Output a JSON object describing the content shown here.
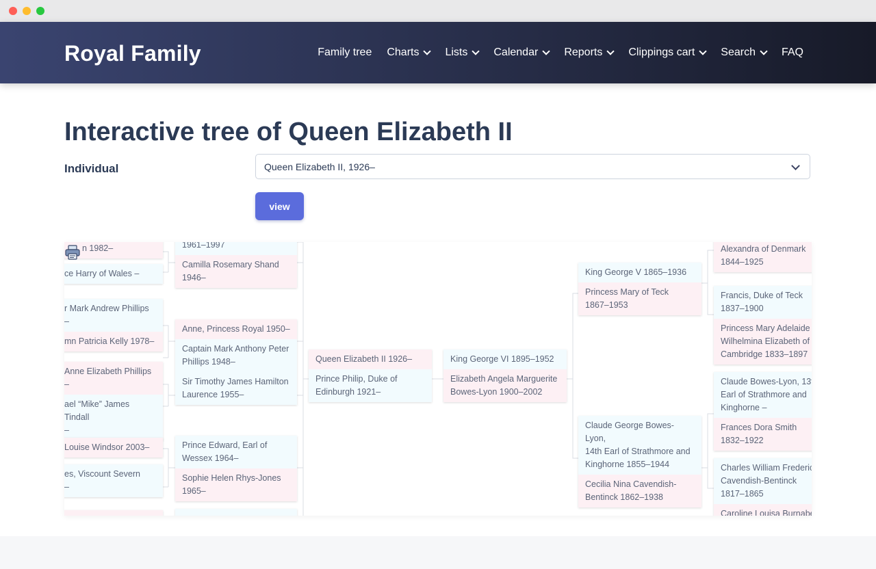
{
  "site": {
    "brand": "Royal Family",
    "menu": [
      {
        "label": "Family tree",
        "dropdown": false
      },
      {
        "label": "Charts",
        "dropdown": true
      },
      {
        "label": "Lists",
        "dropdown": true
      },
      {
        "label": "Calendar",
        "dropdown": true
      },
      {
        "label": "Reports",
        "dropdown": true
      },
      {
        "label": "Clippings cart",
        "dropdown": true
      },
      {
        "label": "Search",
        "dropdown": true
      },
      {
        "label": "FAQ",
        "dropdown": false
      }
    ]
  },
  "page": {
    "title": "Interactive tree of Queen Elizabeth II",
    "individual_label": "Individual",
    "individual_value": "Queen Elizabeth II, 1926–",
    "view_button": "view"
  },
  "tree": {
    "print_icon": "printer-icon",
    "col_desc2": [
      [
        "n 1982–"
      ],
      [
        "ce Harry of Wales –"
      ],
      [
        "r Mark Andrew Phillips",
        "–"
      ],
      [
        "mn Patricia Kelly 1978–"
      ],
      [
        "Anne Elizabeth Phillips",
        "–"
      ],
      [
        "ael “Mike” James Tindall",
        "–"
      ],
      [
        "Louise Windsor 2003–"
      ],
      [
        "es, Viscount Severn",
        "–"
      ]
    ],
    "col_desc1": [
      [
        "1961–1997"
      ],
      [
        "Camilla Rosemary Shand",
        "1946–"
      ],
      [
        "Anne, Princess Royal 1950–"
      ],
      [
        "Captain Mark Anthony Peter",
        "Phillips 1948–"
      ],
      [
        "Sir Timothy James Hamilton",
        "Laurence 1955–"
      ],
      [
        "Prince Edward, Earl of",
        "Wessex 1964–"
      ],
      [
        "Sophie Helen Rhys-Jones",
        "1965–"
      ]
    ],
    "root": [
      [
        "Queen Elizabeth II 1926–"
      ],
      [
        "Prince Philip, Duke of",
        "Edinburgh 1921–"
      ]
    ],
    "parents": [
      [
        "King George VI 1895–1952"
      ],
      [
        "Elizabeth Angela Marguerite",
        "Bowes-Lyon 1900–2002"
      ]
    ],
    "grandparents": [
      [
        "King George V 1865–1936"
      ],
      [
        "Princess Mary of Teck",
        "1867–1953"
      ],
      [
        "Claude George Bowes-Lyon,",
        "14th Earl of Strathmore and",
        "Kinghorne 1855–1944"
      ],
      [
        "Cecilia Nina Cavendish-",
        "Bentinck 1862–1938"
      ]
    ],
    "great_grandparents": [
      [
        "Alexandra of Denmark",
        "1844–1925"
      ],
      [
        "Francis, Duke of Teck",
        "1837–1900"
      ],
      [
        "Princess Mary Adelaide",
        "Wilhelmina Elizabeth of",
        "Cambridge 1833–1897"
      ],
      [
        "Claude Bowes-Lyon, 13t",
        "Earl of Strathmore and",
        "Kinghorne –"
      ],
      [
        "Frances Dora Smith",
        "1832–1922"
      ],
      [
        "Charles William Frederic",
        "Cavendish-Bentinck",
        "1817–1865"
      ],
      [
        "Caroline Louisa Burnabe"
      ]
    ]
  }
}
